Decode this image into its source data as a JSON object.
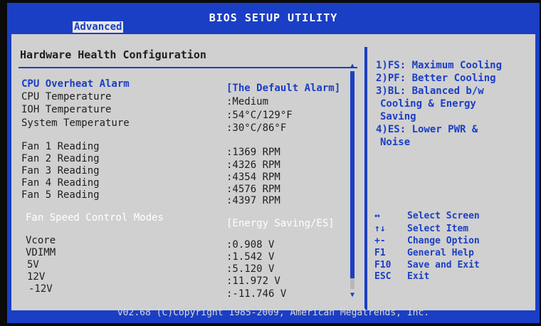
{
  "header": {
    "title": "BIOS SETUP UTILITY",
    "active_tab": "Advanced"
  },
  "screen": {
    "heading": "Hardware Health Configuration",
    "rows": {
      "cpu_alarm_label": "CPU Overheat Alarm",
      "cpu_alarm_value": "[The Default Alarm]",
      "cpu_temp_label": "CPU Temperature",
      "cpu_temp_value": ":Medium",
      "ioh_temp_label": "IOH Temperature",
      "ioh_temp_value": ":54°C/129°F",
      "sys_temp_label": "System Temperature",
      "sys_temp_value": ":30°C/86°F",
      "fan1_label": "Fan 1 Reading",
      "fan1_value": ":1369 RPM",
      "fan2_label": "Fan 2 Reading",
      "fan2_value": ":4326 RPM",
      "fan3_label": "Fan 3 Reading",
      "fan3_value": ":4354 RPM",
      "fan4_label": "Fan 4 Reading",
      "fan4_value": ":4576 RPM",
      "fan5_label": "Fan 5 Reading",
      "fan5_value": ":4397 RPM",
      "fan_mode_label": "Fan Speed Control Modes",
      "fan_mode_value": "[Energy Saving/ES]",
      "vcore_label": "Vcore",
      "vcore_value": ":0.908 V",
      "vdimm_label": "VDIMM",
      "vdimm_value": ":1.542 V",
      "v5_label": "5V",
      "v5_value": ":5.120 V",
      "v12_label": "12V",
      "v12_value": ":11.972 V",
      "vneg12_label": "-12V",
      "vneg12_value": ":-11.746 V"
    }
  },
  "help": {
    "lines": [
      "1)FS: Maximum Cooling",
      "2)PF: Better Cooling",
      "3)BL: Balanced b/w",
      "Cooling & Energy",
      "Saving",
      "4)ES: Lower PWR &",
      "Noise"
    ],
    "keys": [
      {
        "key": "↔",
        "action": "Select Screen"
      },
      {
        "key": "↑↓",
        "action": "Select Item"
      },
      {
        "key": "+-",
        "action": "Change Option"
      },
      {
        "key": "F1",
        "action": "General Help"
      },
      {
        "key": "F10",
        "action": "Save and Exit"
      },
      {
        "key": "ESC",
        "action": "Exit"
      }
    ]
  },
  "scrollbar": {
    "position_fraction": 0.95,
    "up_arrow": "▲",
    "down_arrow": "▼"
  },
  "footer": {
    "text": "v02.68 (C)Copyright 1985-2009, American Megatrends, Inc."
  },
  "colors": {
    "bios_blue": "#1a3fc4",
    "panel_gray": "#d0d0d0",
    "text_dark": "#1e1e1e",
    "highlight_white": "#ffffff"
  }
}
